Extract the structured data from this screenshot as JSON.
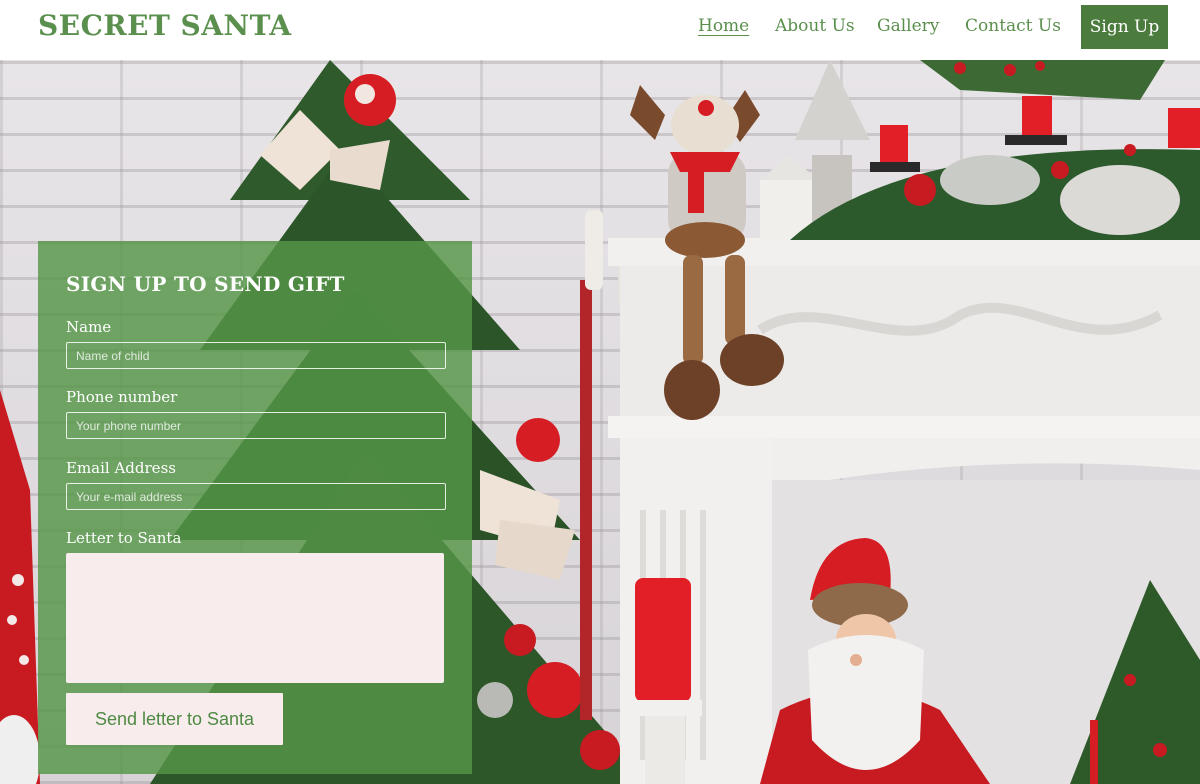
{
  "header": {
    "brand": "SECRET SANTA",
    "nav": {
      "home": "Home",
      "about": "About Us",
      "gallery": "Gallery",
      "contact": "Contact Us"
    },
    "signup_label": "Sign Up"
  },
  "form": {
    "title": "SIGN UP TO SEND GIFT",
    "name_label": "Name",
    "name_placeholder": "Name of child",
    "name_value": "",
    "phone_label": "Phone number",
    "phone_placeholder": "Your phone number",
    "phone_value": "",
    "email_label": "Email Address",
    "email_placeholder": "Your e-mail address",
    "email_value": "",
    "letter_label": "Letter to Santa",
    "letter_value": "",
    "submit_label": "Send letter to Santa"
  },
  "colors": {
    "brand_green": "#5a8f4d",
    "button_green": "#4b7c3e",
    "panel_green": "#569648",
    "field_bg": "#f8eced",
    "accent_red": "#d71d24"
  }
}
